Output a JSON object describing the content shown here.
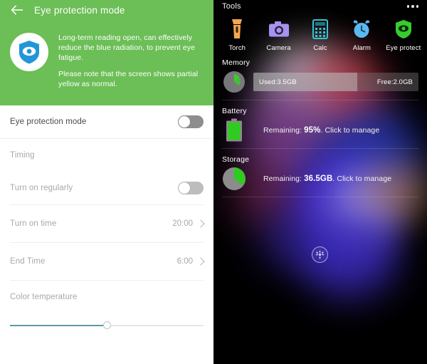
{
  "left": {
    "header": {
      "title": "Eye protection mode",
      "back_icon": "arrow-left-icon",
      "bg_color": "#6cbe56"
    },
    "banner": {
      "icon": "shield-eye-icon",
      "line1": "Long-term reading open, can effectively reduce the blue radiation, to prevent eye fatigue.",
      "line2": "Please note that the screen shows partial yellow as normal."
    },
    "rows": {
      "eye_protection": {
        "label": "Eye protection mode",
        "toggle_state": "off"
      },
      "timing_section": {
        "label": "Timing"
      },
      "turn_on_regularly": {
        "label": "Turn on regularly",
        "toggle_state": "off"
      },
      "turn_on_time": {
        "label": "Turn on time",
        "value": "20:00",
        "chevron": "chevron-right-icon"
      },
      "end_time": {
        "label": "End Time",
        "value": "6:00",
        "chevron": "chevron-right-icon"
      },
      "color_temperature": {
        "label": "Color temperature",
        "slider_percent": 50,
        "fill_color": "#5b9aa8"
      }
    }
  },
  "right": {
    "header": {
      "title": "Tools",
      "menu_icon": "more-horizontal-icon"
    },
    "tools": [
      {
        "label": "Torch",
        "icon": "flashlight-icon",
        "color": "#f6a552"
      },
      {
        "label": "Camera",
        "icon": "camera-icon",
        "color": "#a892f0"
      },
      {
        "label": "Calc",
        "icon": "calculator-icon",
        "color": "#2fc6d6"
      },
      {
        "label": "Alarm",
        "icon": "alarm-clock-icon",
        "color": "#5cb8f0"
      },
      {
        "label": "Eye protect",
        "icon": "shield-eye-icon",
        "color": "#37cc2e"
      }
    ],
    "memory": {
      "title": "Memory",
      "icon": "memory-gauge-icon",
      "used_label": "Used:3.5GB",
      "free_label": "Free:2.0GB",
      "used_percent": 63
    },
    "battery": {
      "title": "Battery",
      "icon": "battery-full-icon",
      "text_prefix": "Remaining: ",
      "value": "95%",
      "text_suffix": ". Click to manage",
      "level_percent": 95,
      "color": "#2ecc1f"
    },
    "storage": {
      "title": "Storage",
      "icon": "storage-pie-icon",
      "text_prefix": "Remaining: ",
      "value": "36.5GB",
      "text_suffix": ". Click to manage",
      "free_percent": 25,
      "color": "#2ecc1f"
    },
    "float_button": {
      "icon": "clean-gear-icon"
    }
  }
}
